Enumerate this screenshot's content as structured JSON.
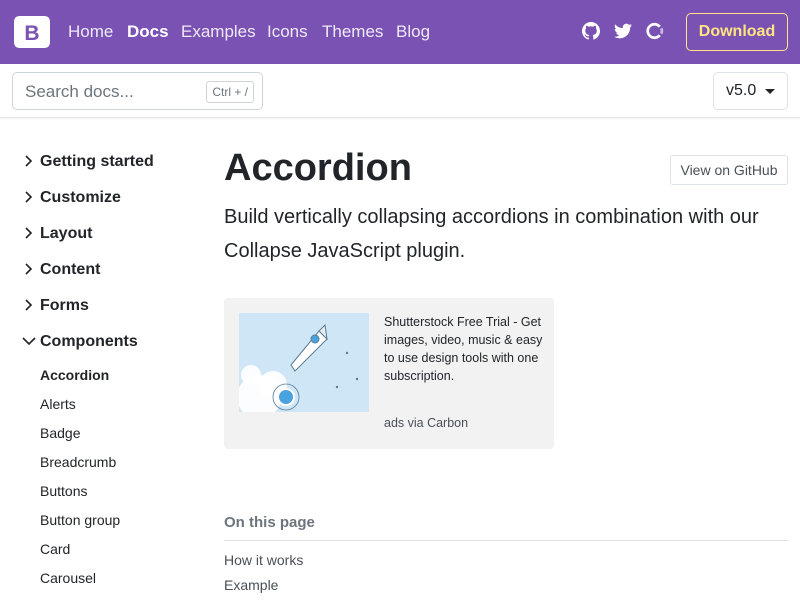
{
  "navbar": {
    "brand_letter": "B",
    "links": [
      "Home",
      "Docs",
      "Examples",
      "Icons",
      "Themes",
      "Blog"
    ],
    "active_link": "Docs",
    "download_label": "Download",
    "icons": [
      "github-icon",
      "twitter-icon",
      "opencollective-icon"
    ],
    "colors": {
      "background": "#7952b3",
      "download": "#ffe484"
    }
  },
  "search": {
    "placeholder": "Search docs...",
    "shortcut": "Ctrl + /"
  },
  "version": {
    "selected": "v5.0"
  },
  "sidebar": {
    "groups": [
      {
        "label": "Getting started",
        "expanded": false
      },
      {
        "label": "Customize",
        "expanded": false
      },
      {
        "label": "Layout",
        "expanded": false
      },
      {
        "label": "Content",
        "expanded": false
      },
      {
        "label": "Forms",
        "expanded": false
      },
      {
        "label": "Components",
        "expanded": true
      }
    ],
    "items": [
      "Accordion",
      "Alerts",
      "Badge",
      "Breadcrumb",
      "Buttons",
      "Button group",
      "Card",
      "Carousel"
    ],
    "active_item": "Accordion"
  },
  "main": {
    "title": "Accordion",
    "github_label": "View on GitHub",
    "lead": "Build vertically collapsing accordions in combination with our Collapse JavaScript plugin."
  },
  "ad": {
    "text": "Shutterstock Free Trial - Get images, video, music & easy to use design tools with one subscription.",
    "via": "ads via Carbon"
  },
  "toc": {
    "title": "On this page",
    "items": [
      "How it works",
      "Example"
    ]
  }
}
